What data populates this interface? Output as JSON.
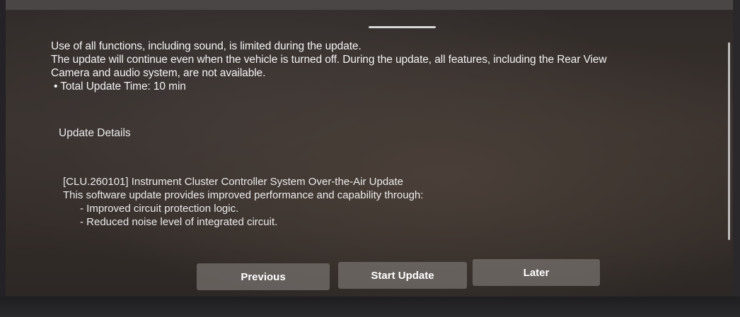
{
  "intro": {
    "line1": "Use of all functions, including sound, is limited during the update.",
    "line2": "The update will continue even when the vehicle is turned off. During the update, all features, including the Rear View",
    "line3": "Camera and audio system, are not available.",
    "total_time": "• Total Update Time: 10 min"
  },
  "details": {
    "title": "Update Details",
    "heading": "[CLU.260101] Instrument Cluster Controller System Over-the-Air Update",
    "summary": "This software update provides improved performance and capability through:",
    "items": [
      "- Improved circuit protection logic.",
      "- Reduced noise level of integrated circuit."
    ]
  },
  "buttons": {
    "previous": "Previous",
    "start": "Start Update",
    "later": "Later"
  }
}
